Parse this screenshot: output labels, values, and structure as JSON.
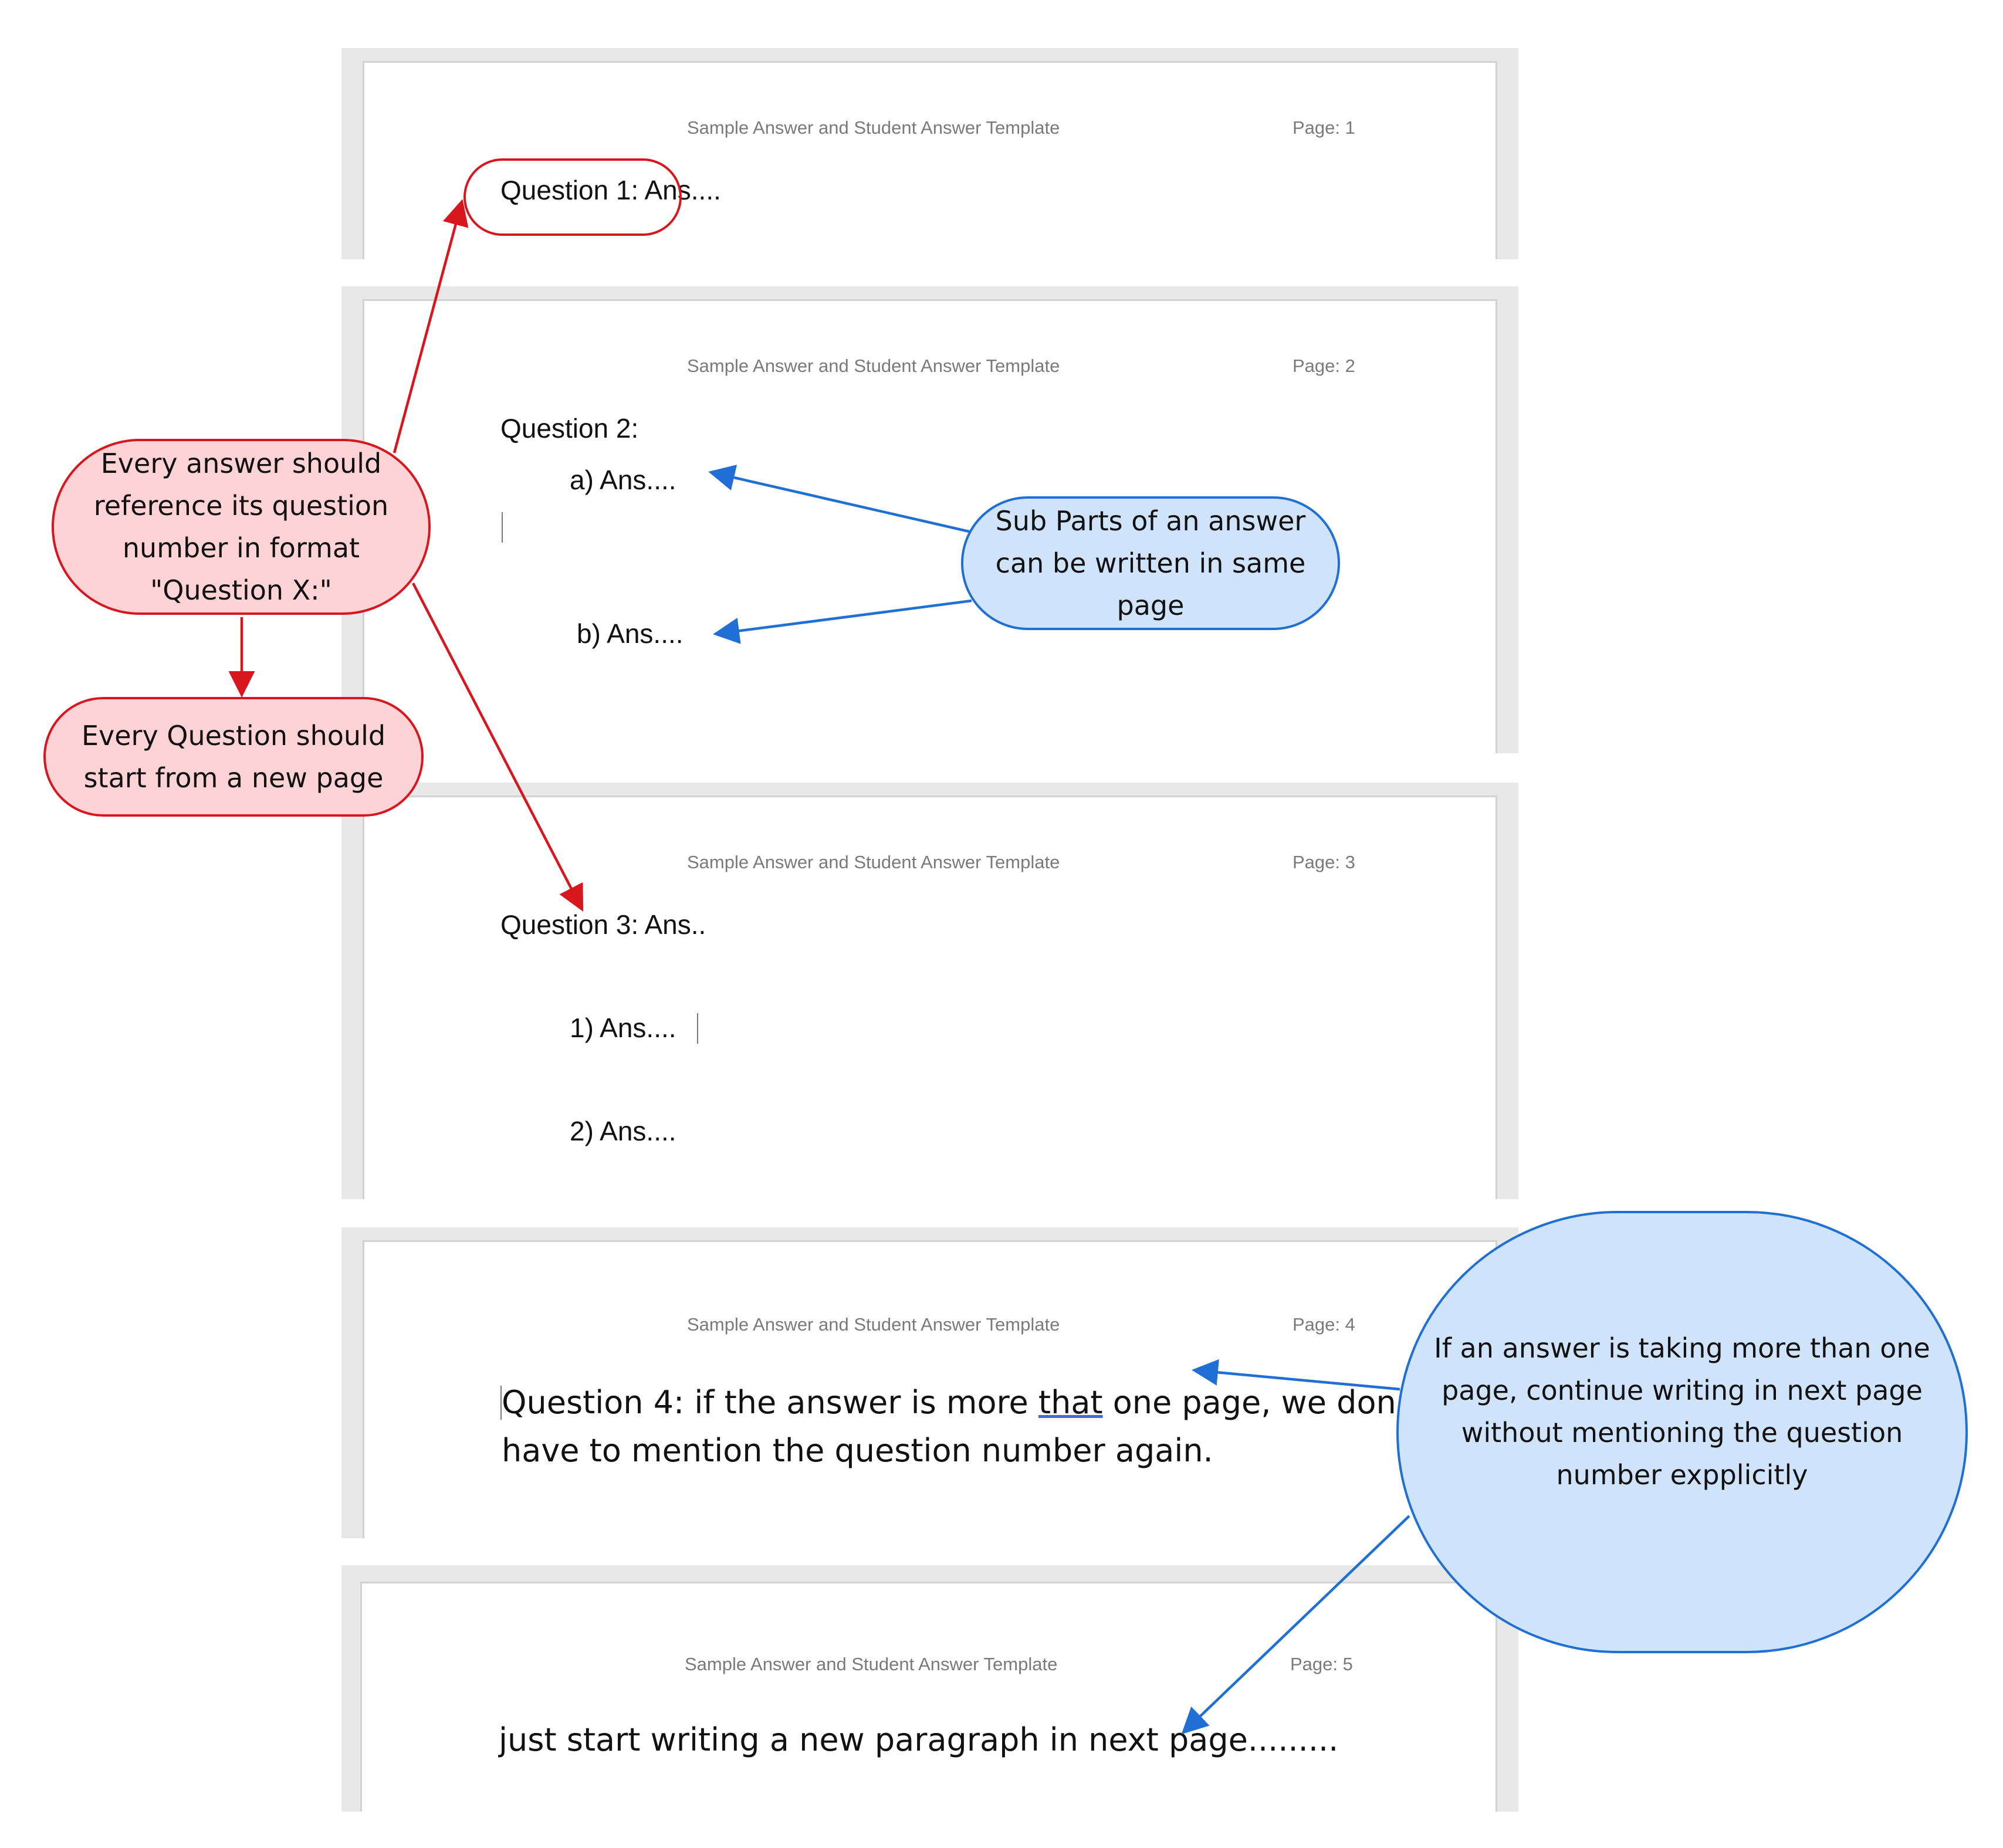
{
  "header_text": "Sample Answer and Student Answer Template",
  "pages": [
    {
      "page_label": "Page: 1",
      "lines": [
        "Question 1: Ans...."
      ]
    },
    {
      "page_label": "Page: 2",
      "question": "Question 2:",
      "sub_a": "a)   Ans....",
      "sub_b": "b) Ans...."
    },
    {
      "page_label": "Page: 3",
      "question": "Question 3: Ans..",
      "sub_1": "1) Ans....",
      "sub_2": "2) Ans...."
    },
    {
      "page_label": "Page: 4",
      "line1_before": "Question 4: if the answer is more ",
      "line1_under": "that",
      "line1_after": " one page, we don’t",
      "line2": "have to mention the question number again."
    },
    {
      "page_label": "Page: 5",
      "line1": "just start writing a new paragraph in next page........."
    }
  ],
  "callouts": {
    "reference": "Every answer should reference its question number in format \"Question X:\"",
    "new_page": "Every Question should start from a new page",
    "sub_parts": "Sub Parts of an answer can be written in same page",
    "continue": "If an answer is taking more than one page, continue writing in next page without mentioning the question number expplicitly"
  },
  "colors": {
    "red_stroke": "#d8161e",
    "red_fill": "#fdd3d5",
    "blue_stroke": "#1f6fd4",
    "blue_fill": "#cfe3fb"
  }
}
